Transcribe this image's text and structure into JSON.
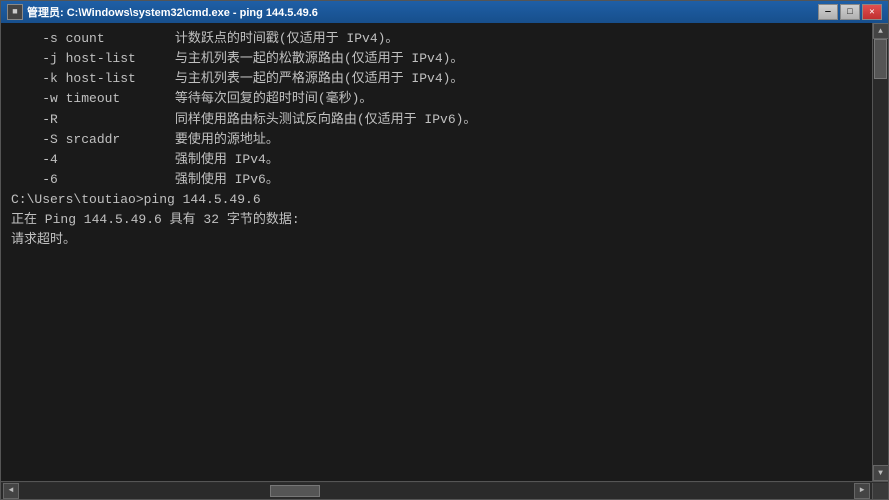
{
  "window": {
    "title": "管理员: C:\\Windows\\system32\\cmd.exe - ping 144.5.49.6",
    "icon_char": "■"
  },
  "titlebar_buttons": {
    "minimize": "—",
    "maximize": "□",
    "close": "✕"
  },
  "terminal": {
    "lines": [
      {
        "text": "    -s count         计数跃点的时间戳(仅适用于 IPv4)。"
      },
      {
        "text": "    -j host-list     与主机列表一起的松散源路由(仅适用于 IPv4)。"
      },
      {
        "text": "    -k host-list     与主机列表一起的严格源路由(仅适用于 IPv4)。"
      },
      {
        "text": "    -w timeout       等待每次回复的超时时间(毫秒)。"
      },
      {
        "text": "    -R               同样使用路由标头测试反向路由(仅适用于 IPv6)。"
      },
      {
        "text": "    -S srcaddr       要使用的源地址。"
      },
      {
        "text": "    -4               强制使用 IPv4。"
      },
      {
        "text": "    -6               强制使用 IPv6。"
      },
      {
        "text": ""
      },
      {
        "text": ""
      },
      {
        "text": "C:\\Users\\toutiao>ping 144.5.49.6"
      },
      {
        "text": ""
      },
      {
        "text": "正在 Ping 144.5.49.6 具有 32 字节的数据:"
      },
      {
        "text": "请求超时。"
      }
    ]
  }
}
